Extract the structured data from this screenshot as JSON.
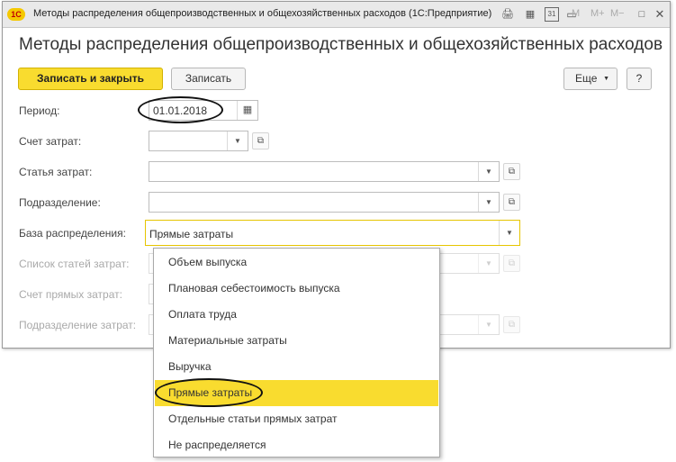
{
  "window": {
    "logo": "1С",
    "title": "Методы распределения общепроизводственных и общехозяйственных расходов  (1С:Предприятие)",
    "toolbar": {
      "memory_plus": "M+",
      "memory_minus": "M−",
      "memory": "M",
      "calendar_day": "31"
    }
  },
  "form": {
    "title": "Методы распределения общепроизводственных и общехозяйственных расходов",
    "buttons": {
      "save_close": "Записать и закрыть",
      "save": "Записать",
      "more": "Еще",
      "help": "?"
    },
    "fields": {
      "period": {
        "label": "Период:",
        "value": "01.01.2018"
      },
      "cost_account": {
        "label": "Счет затрат:",
        "value": ""
      },
      "cost_item": {
        "label": "Статья затрат:",
        "value": ""
      },
      "department": {
        "label": "Подразделение:",
        "value": ""
      },
      "distribution_base": {
        "label": "База распределения:",
        "value": "Прямые затраты"
      },
      "cost_item_list": {
        "label": "Список статей затрат:",
        "value": ""
      },
      "direct_cost_account": {
        "label": "Счет прямых затрат:",
        "value": ""
      },
      "cost_department": {
        "label": "Подразделение затрат:",
        "value": ""
      }
    }
  },
  "dropdown": {
    "selected_index": 5,
    "options": [
      "Объем выпуска",
      "Плановая себестоимость выпуска",
      "Оплата труда",
      "Материальные затраты",
      "Выручка",
      "Прямые затраты",
      "Отдельные статьи прямых затрат",
      "Не распределяется"
    ]
  },
  "colors": {
    "accent": "#f9dc2f",
    "window_border": "#9a9a9a",
    "disabled_text": "#a9a9a9"
  }
}
